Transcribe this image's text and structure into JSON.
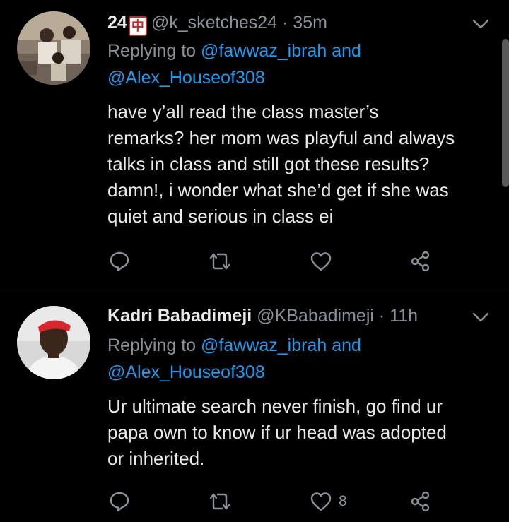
{
  "tweets": [
    {
      "display_name": "24",
      "name_badge": "中",
      "handle": "@k_sketches24",
      "separator": "·",
      "time": "35m",
      "replying_to": "Replying to",
      "mention1": "@fawwaz_ibrah",
      "and": "and",
      "mention2": "@Alex_Houseof308",
      "body": [
        "have y’all read the class master’s",
        "remarks? her mom was playful and always",
        "talks in class and still got these results?",
        "damn!, i wonder what she’d get if she was",
        "quiet and serious in class ei"
      ],
      "likes": ""
    },
    {
      "display_name": "Kadri Babadimeji",
      "handle": "@KBabadimeji",
      "separator": "·",
      "time": "11h",
      "replying_to": "Replying to",
      "mention1": "@fawwaz_ibrah",
      "and": "and",
      "mention2": "@Alex_Houseof308",
      "body": [
        "Ur ultimate search never finish, go find ur",
        "papa own to know if ur head was adopted",
        "or inherited."
      ],
      "likes": "8"
    }
  ],
  "icons": {
    "reply": "reply-icon",
    "retweet": "retweet-icon",
    "like": "heart-icon",
    "share": "share-icon",
    "more": "chevron-down-icon"
  },
  "colors": {
    "background": "#000000",
    "text": "#e7e9ea",
    "muted": "#8a9299",
    "link": "#1d9bf0",
    "divider": "#2f3336"
  }
}
